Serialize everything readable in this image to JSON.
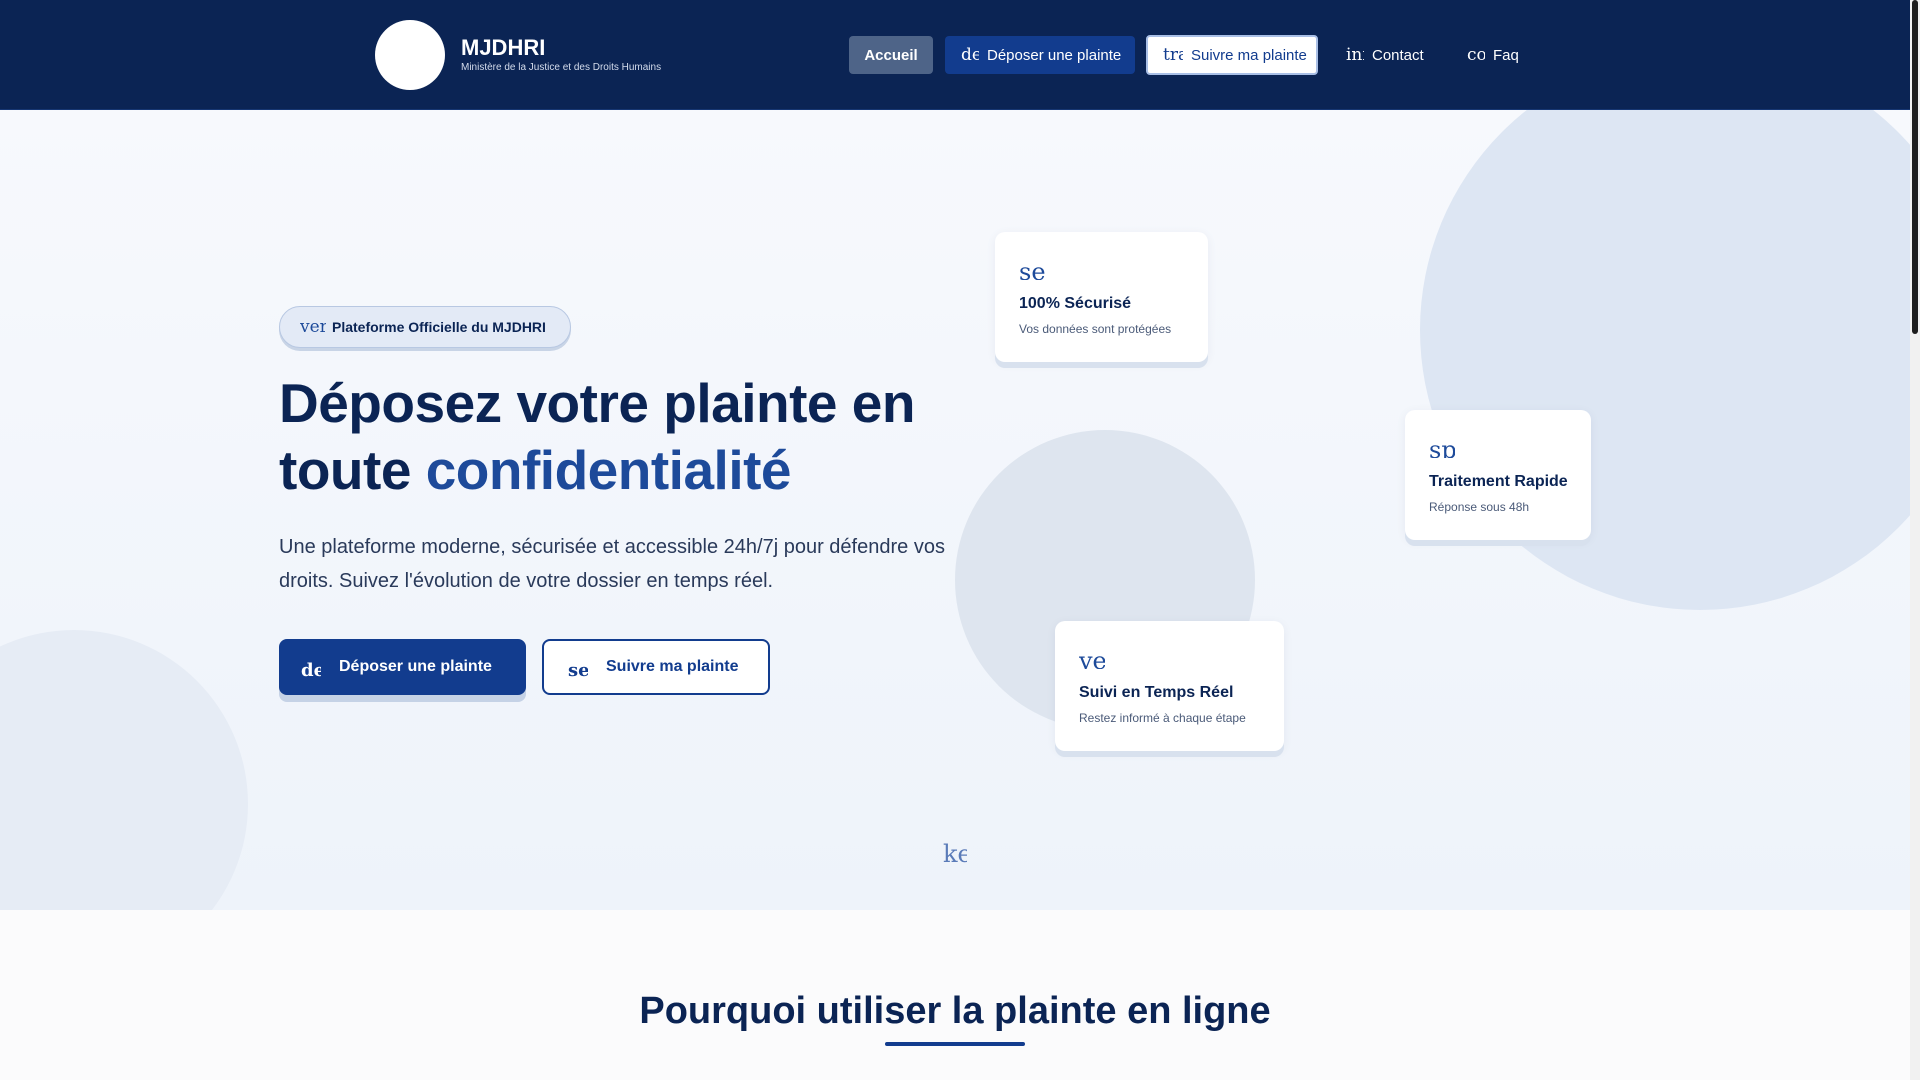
{
  "header": {
    "brand_title": "MJDHRI",
    "brand_subtitle": "Ministère de la Justice et des Droits Humains",
    "nav": {
      "accueil": "Accueil",
      "deposer": "Déposer une plainte",
      "deposer_icon": "de",
      "suivre": "Suivre ma plainte",
      "suivre_icon": "tra",
      "contact": "Contact",
      "contact_icon": "inf",
      "faq": "Faq",
      "faq_icon": "co"
    }
  },
  "hero": {
    "badge_icon": "ver",
    "badge_text": "Plateforme Officielle du MJDHRI",
    "title_line1": "Déposez votre plainte en",
    "title_line2_plain": "toute ",
    "title_line2_accent": "confidentialité",
    "description": "Une plateforme moderne, sécurisée et accessible 24h/7j pour défendre vos droits. Suivez l'évolution de votre dossier en temps réel.",
    "primary_button": "Déposer une plainte",
    "primary_button_icon": "de",
    "secondary_button": "Suivre ma plainte",
    "secondary_button_icon": "se",
    "scroll_icon": "ke"
  },
  "features": [
    {
      "icon": "se",
      "title": "100% Sécurisé",
      "desc": "Vos données sont protégées"
    },
    {
      "icon": "sp",
      "title": "Traitement Rapide",
      "desc": "Réponse sous 48h"
    },
    {
      "icon": "ve",
      "title": "Suivi en Temps Réel",
      "desc": "Restez informé à chaque étape"
    }
  ],
  "section2": {
    "title": "Pourquoi utiliser la plainte en ligne"
  },
  "colors": {
    "navy": "#0b2454",
    "primary": "#123c8e",
    "accent": "#1d4a9a"
  }
}
